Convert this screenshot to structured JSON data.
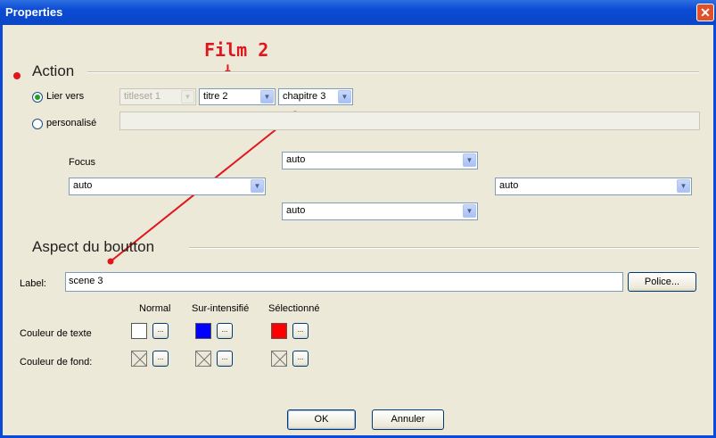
{
  "window": {
    "title": "Properties",
    "close_glyph": "✕"
  },
  "action": {
    "heading": "Action",
    "link_radio": {
      "label": "Lier vers",
      "checked": true
    },
    "titleset": {
      "value": "titleset 1"
    },
    "title": {
      "value": "titre 2"
    },
    "chapter": {
      "value": "chapitre 3"
    },
    "custom_radio": {
      "label": "personalisé",
      "checked": false
    }
  },
  "focus": {
    "label": "Focus",
    "up": "auto",
    "left": "auto",
    "right": "auto",
    "down": "auto"
  },
  "aspect": {
    "heading": "Aspect du boutton",
    "label_caption": "Label:",
    "label_value": "scene 3",
    "font_button": "Police...",
    "columns": [
      "Normal",
      "Sur-intensifié",
      "Sélectionné"
    ],
    "text_color_label": "Couleur de texte",
    "bg_color_label": "Couleur de fond:",
    "text_colors": [
      "#ffffff",
      "#0000ff",
      "#ff0000"
    ],
    "picker_glyph": "..."
  },
  "buttons": {
    "ok": "OK",
    "cancel": "Annuler"
  },
  "annotation": {
    "text": "Film 2",
    "arrow": "↓",
    "color": "#e0161d"
  }
}
